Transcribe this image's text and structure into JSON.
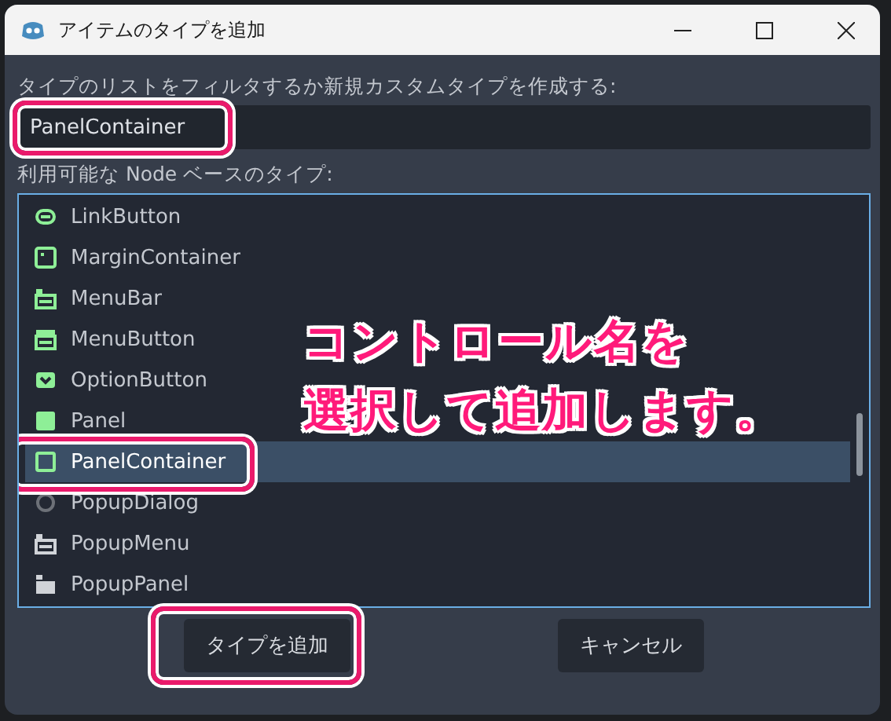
{
  "window": {
    "title": "アイテムのタイプを追加"
  },
  "filter": {
    "label": "タイプのリストをフィルタするか新規カスタムタイプを作成する:",
    "value": "PanelContainer"
  },
  "list": {
    "label": "利用可能な Node ベースのタイプ:",
    "items": [
      {
        "name": "LinkButton",
        "kind": "link",
        "selected": false
      },
      {
        "name": "MarginContainer",
        "kind": "margin",
        "selected": false
      },
      {
        "name": "MenuBar",
        "kind": "menubar",
        "selected": false
      },
      {
        "name": "MenuButton",
        "kind": "menubutton",
        "selected": false
      },
      {
        "name": "OptionButton",
        "kind": "option",
        "selected": false
      },
      {
        "name": "Panel",
        "kind": "panel",
        "selected": false
      },
      {
        "name": "PanelContainer",
        "kind": "panelcontainer",
        "selected": true
      },
      {
        "name": "PopupDialog",
        "kind": "popupdialog",
        "selected": false
      },
      {
        "name": "PopupMenu",
        "kind": "popupmenu",
        "selected": false
      },
      {
        "name": "PopupPanel",
        "kind": "popuppanel",
        "selected": false
      }
    ]
  },
  "annotation": [
    "コントロール名を",
    "選択して追加します。"
  ],
  "buttons": [
    {
      "label": "タイプを追加",
      "highlighted": true
    },
    {
      "label": "キャンセル",
      "highlighted": false
    }
  ]
}
